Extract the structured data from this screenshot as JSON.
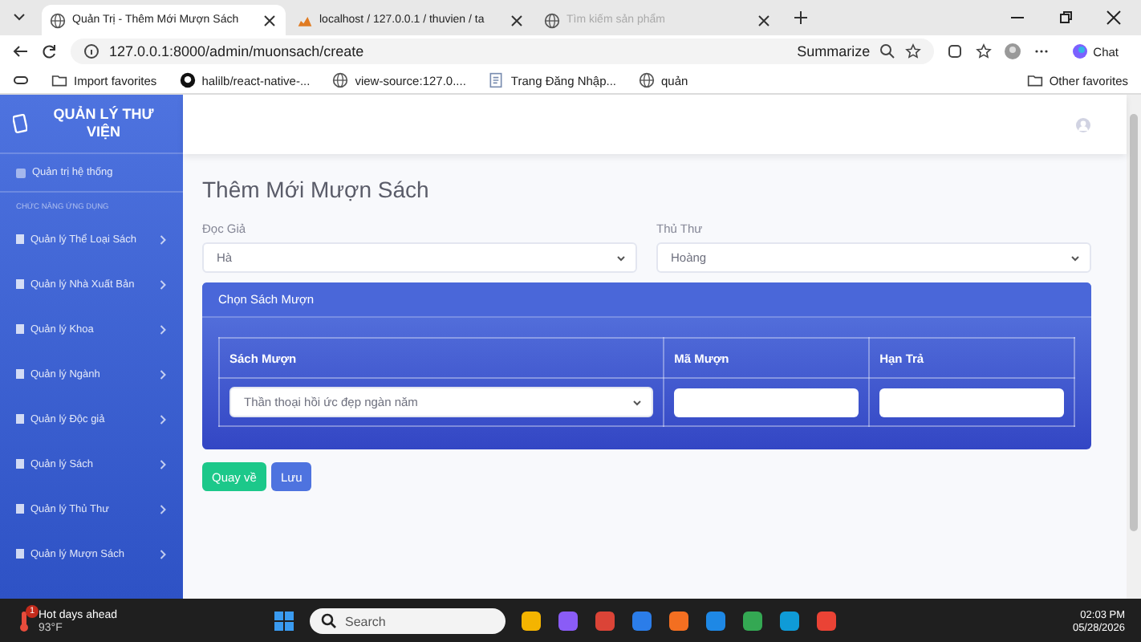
{
  "browser": {
    "tabs": [
      {
        "title": "Quản Trị - Thêm Mới Mượn Sách",
        "kind": "globe",
        "selected": true,
        "sleeping": false
      },
      {
        "title": "localhost / 127.0.0.1 / thuvien / ta",
        "kind": "database",
        "selected": false,
        "sleeping": false
      },
      {
        "title": "Tìm kiếm sản phẩm",
        "kind": "globe",
        "selected": false,
        "sleeping": true
      }
    ],
    "address": "127.0.0.1:8000/admin/muonsach/create",
    "summarize": "Summarize",
    "chat": "Chat",
    "bookmarks": [
      {
        "label": "Import favorites",
        "kind": "import"
      },
      {
        "label": "halilb/react-native-...",
        "kind": "github"
      },
      {
        "label": "view-source:127.0....",
        "kind": "globe"
      },
      {
        "label": "Trang Đăng Nhập...",
        "kind": "page"
      },
      {
        "label": "quản",
        "kind": "globe"
      }
    ],
    "other_favorites": "Other favorites"
  },
  "sidebar": {
    "brand": "QUẢN LÝ THƯ VIỆN",
    "dashboard": "Quản trị hệ thống",
    "section": "CHỨC NĂNG ỨNG DỤNG",
    "items": [
      {
        "label": "Quản lý Thể Loại Sách"
      },
      {
        "label": "Quản lý Nhà Xuất Bản"
      },
      {
        "label": "Quản lý Khoa"
      },
      {
        "label": "Quản lý Ngành"
      },
      {
        "label": "Quản lý Độc giả"
      },
      {
        "label": "Quản lý Sách"
      },
      {
        "label": "Quản lý Thủ Thư"
      },
      {
        "label": "Quản lý Mượn Sách"
      }
    ]
  },
  "form": {
    "title": "Thêm Mới Mượn Sách",
    "fields": [
      {
        "label": "Đọc Giả",
        "value": "Hà"
      },
      {
        "label": "Thủ Thư",
        "value": "Hoàng"
      }
    ],
    "card_title": "Chọn Sách Mượn",
    "columns": [
      "Sách Mượn",
      "Mã Mượn",
      "Hạn Trả"
    ],
    "book": "Thần thoại hồi ức đẹp ngàn năm",
    "buttons": [
      {
        "label": "Quay về",
        "kind": "back"
      },
      {
        "label": "Lưu",
        "kind": "save"
      }
    ]
  },
  "taskbar": {
    "weather_title": "Hot days ahead",
    "weather_temp": "93°F",
    "weather_badge": "1",
    "search_placeholder": "Search",
    "time": "02:03 PM",
    "date": "05/28/2026"
  }
}
